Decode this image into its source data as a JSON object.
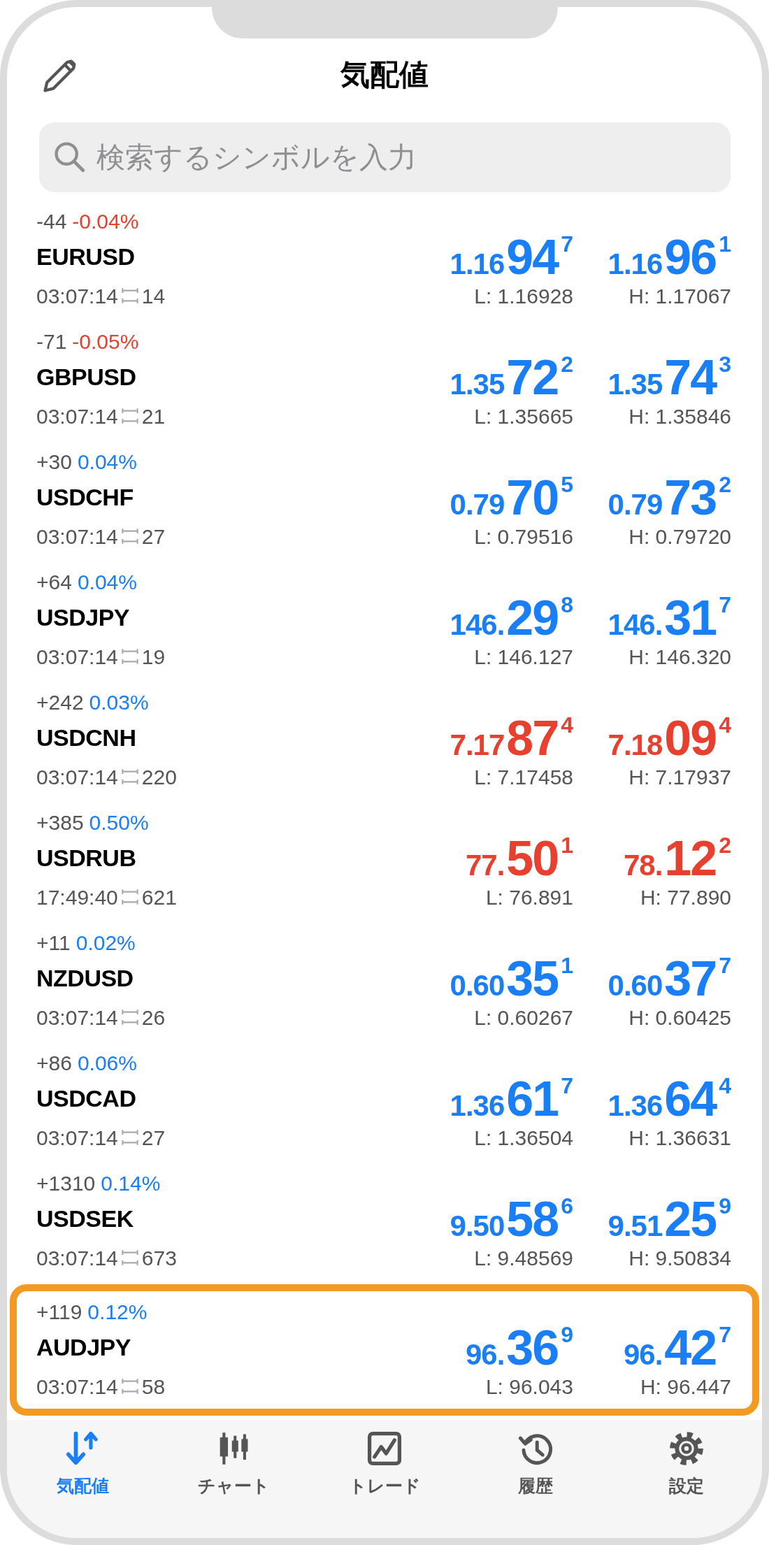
{
  "header": {
    "title": "気配値"
  },
  "search": {
    "placeholder": "検索するシンボルを入力"
  },
  "rows": [
    {
      "change": "-44",
      "percent": "-0.04%",
      "change_down": true,
      "symbol": "EURUSD",
      "time": "03:07:14",
      "spread": "14",
      "price_down": false,
      "bid": {
        "lead": "1.16",
        "big": "94",
        "pip": "7"
      },
      "ask": {
        "lead": "1.16",
        "big": "96",
        "pip": "1"
      },
      "low": "L: 1.16928",
      "high": "H: 1.17067",
      "highlighted": false
    },
    {
      "change": "-71",
      "percent": "-0.05%",
      "change_down": true,
      "symbol": "GBPUSD",
      "time": "03:07:14",
      "spread": "21",
      "price_down": false,
      "bid": {
        "lead": "1.35",
        "big": "72",
        "pip": "2"
      },
      "ask": {
        "lead": "1.35",
        "big": "74",
        "pip": "3"
      },
      "low": "L: 1.35665",
      "high": "H: 1.35846",
      "highlighted": false
    },
    {
      "change": "+30",
      "percent": "0.04%",
      "change_down": false,
      "symbol": "USDCHF",
      "time": "03:07:14",
      "spread": "27",
      "price_down": false,
      "bid": {
        "lead": "0.79",
        "big": "70",
        "pip": "5"
      },
      "ask": {
        "lead": "0.79",
        "big": "73",
        "pip": "2"
      },
      "low": "L: 0.79516",
      "high": "H: 0.79720",
      "highlighted": false
    },
    {
      "change": "+64",
      "percent": "0.04%",
      "change_down": false,
      "symbol": "USDJPY",
      "time": "03:07:14",
      "spread": "19",
      "price_down": false,
      "bid": {
        "lead": "146.",
        "big": "29",
        "pip": "8"
      },
      "ask": {
        "lead": "146.",
        "big": "31",
        "pip": "7"
      },
      "low": "L: 146.127",
      "high": "H: 146.320",
      "highlighted": false
    },
    {
      "change": "+242",
      "percent": "0.03%",
      "change_down": false,
      "symbol": "USDCNH",
      "time": "03:07:14",
      "spread": "220",
      "price_down": true,
      "bid": {
        "lead": "7.17",
        "big": "87",
        "pip": "4"
      },
      "ask": {
        "lead": "7.18",
        "big": "09",
        "pip": "4"
      },
      "low": "L: 7.17458",
      "high": "H: 7.17937",
      "highlighted": false
    },
    {
      "change": "+385",
      "percent": "0.50%",
      "change_down": false,
      "symbol": "USDRUB",
      "time": "17:49:40",
      "spread": "621",
      "price_down": true,
      "bid": {
        "lead": "77.",
        "big": "50",
        "pip": "1"
      },
      "ask": {
        "lead": "78.",
        "big": "12",
        "pip": "2"
      },
      "low": "L: 76.891",
      "high": "H: 77.890",
      "highlighted": false
    },
    {
      "change": "+11",
      "percent": "0.02%",
      "change_down": false,
      "symbol": "NZDUSD",
      "time": "03:07:14",
      "spread": "26",
      "price_down": false,
      "bid": {
        "lead": "0.60",
        "big": "35",
        "pip": "1"
      },
      "ask": {
        "lead": "0.60",
        "big": "37",
        "pip": "7"
      },
      "low": "L: 0.60267",
      "high": "H: 0.60425",
      "highlighted": false
    },
    {
      "change": "+86",
      "percent": "0.06%",
      "change_down": false,
      "symbol": "USDCAD",
      "time": "03:07:14",
      "spread": "27",
      "price_down": false,
      "bid": {
        "lead": "1.36",
        "big": "61",
        "pip": "7"
      },
      "ask": {
        "lead": "1.36",
        "big": "64",
        "pip": "4"
      },
      "low": "L: 1.36504",
      "high": "H: 1.36631",
      "highlighted": false
    },
    {
      "change": "+1310",
      "percent": "0.14%",
      "change_down": false,
      "symbol": "USDSEK",
      "time": "03:07:14",
      "spread": "673",
      "price_down": false,
      "bid": {
        "lead": "9.50",
        "big": "58",
        "pip": "6"
      },
      "ask": {
        "lead": "9.51",
        "big": "25",
        "pip": "9"
      },
      "low": "L: 9.48569",
      "high": "H: 9.50834",
      "highlighted": false
    },
    {
      "change": "+119",
      "percent": "0.12%",
      "change_down": false,
      "symbol": "AUDJPY",
      "time": "03:07:14",
      "spread": "58",
      "price_down": false,
      "bid": {
        "lead": "96.",
        "big": "36",
        "pip": "9"
      },
      "ask": {
        "lead": "96.",
        "big": "42",
        "pip": "7"
      },
      "low": "L: 96.043",
      "high": "H: 96.447",
      "highlighted": true
    }
  ],
  "tabs": [
    {
      "label": "気配値",
      "selected": true
    },
    {
      "label": "チャート",
      "selected": false
    },
    {
      "label": "トレード",
      "selected": false
    },
    {
      "label": "履歴",
      "selected": false
    },
    {
      "label": "設定",
      "selected": false
    }
  ]
}
